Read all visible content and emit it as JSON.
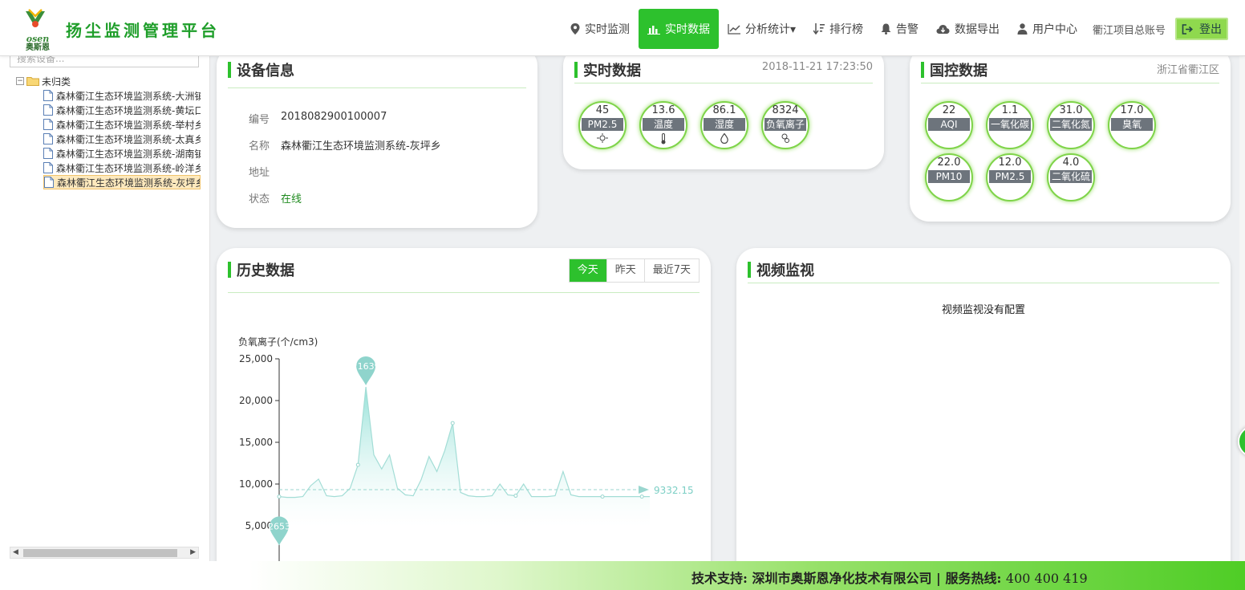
{
  "header": {
    "logo_brand": "osen",
    "logo_cn": "奥斯恩",
    "title": "扬尘监测管理平台",
    "nav": [
      {
        "label": "实时监测",
        "icon": "map-marker-icon"
      },
      {
        "label": "实时数据",
        "icon": "bar-chart-icon",
        "active": true
      },
      {
        "label": "分析统计▾",
        "icon": "line-chart-icon"
      },
      {
        "label": "排行榜",
        "icon": "sort-icon"
      },
      {
        "label": "告警",
        "icon": "bell-icon"
      },
      {
        "label": "数据导出",
        "icon": "cloud-download-icon"
      },
      {
        "label": "用户中心",
        "icon": "user-icon"
      }
    ],
    "account": "衢江项目总账号",
    "logout": "登出",
    "accent_color": "#2dc12d"
  },
  "sidebar": {
    "search_placeholder": "搜索设备...",
    "root_label": "未归类",
    "devices": [
      "森林衢江生态环境监测系统-大洲镇",
      "森林衢江生态环境监测系统-黄坛口",
      "森林衢江生态环境监测系统-举村乡",
      "森林衢江生态环境监测系统-太真乡",
      "森林衢江生态环境监测系统-湖南镇",
      "森林衢江生态环境监测系统-岭洋乡",
      "森林衢江生态环境监测系统-灰坪乡"
    ]
  },
  "device_info": {
    "title": "设备信息",
    "rows": [
      {
        "label": "编号",
        "value": "2018082900100007"
      },
      {
        "label": "名称",
        "value": "森林衢江生态环境监测系统-灰坪乡"
      },
      {
        "label": "地址",
        "value": ""
      },
      {
        "label": "状态",
        "value": "在线"
      }
    ]
  },
  "realtime": {
    "title": "实时数据",
    "timestamp": "2018-11-21 17:23:50",
    "gauges": [
      {
        "value": "45",
        "label": "PM2.5",
        "icon": "dust-icon"
      },
      {
        "value": "13.6",
        "label": "温度",
        "icon": "thermometer-icon"
      },
      {
        "value": "86.1",
        "label": "湿度",
        "icon": "droplet-icon"
      },
      {
        "value": "8324",
        "label": "负氧离子",
        "icon": "ion-icon"
      }
    ]
  },
  "national": {
    "title": "国控数据",
    "location": "浙江省衢江区",
    "gauges": [
      {
        "value": "22",
        "label": "AQI"
      },
      {
        "value": "1.1",
        "label": "一氧化碳"
      },
      {
        "value": "31.0",
        "label": "二氧化氮"
      },
      {
        "value": "17.0",
        "label": "臭氧"
      },
      {
        "value": "22.0",
        "label": "PM10"
      },
      {
        "value": "12.0",
        "label": "PM2.5"
      },
      {
        "value": "4.0",
        "label": "二氧化硫"
      }
    ]
  },
  "history": {
    "title": "历史数据",
    "tabs": [
      "今天",
      "昨天",
      "最近7天"
    ],
    "active_tab": 0
  },
  "chart_data": {
    "type": "area",
    "ylabel": "负氧离子(个/cm3)",
    "ylim": [
      0,
      25000
    ],
    "yticks": [
      "25,000",
      "20,000",
      "15,000",
      "10,000",
      "5,000"
    ],
    "ytick_values": [
      25000,
      20000,
      15000,
      10000,
      5000
    ],
    "max_label": "21639",
    "min_label": "2653",
    "avg_label": "9332.15",
    "avg": 9332.15,
    "series_color": "#9fe3dc",
    "points": [
      [
        0,
        8500
      ],
      [
        1,
        8400
      ],
      [
        2,
        8400
      ],
      [
        3,
        8500
      ],
      [
        4,
        9800
      ],
      [
        5,
        10600
      ],
      [
        6,
        8600
      ],
      [
        7,
        8500
      ],
      [
        8,
        8600
      ],
      [
        9,
        9500
      ],
      [
        10,
        12300
      ],
      [
        11,
        21639
      ],
      [
        12,
        13500
      ],
      [
        13,
        11800
      ],
      [
        14,
        13500
      ],
      [
        15,
        9500
      ],
      [
        16,
        8700
      ],
      [
        17,
        8600
      ],
      [
        18,
        10500
      ],
      [
        19,
        13300
      ],
      [
        20,
        11500
      ],
      [
        21,
        14000
      ],
      [
        22,
        17300
      ],
      [
        23,
        9000
      ],
      [
        24,
        8600
      ],
      [
        25,
        8500
      ],
      [
        26,
        8500
      ],
      [
        27,
        8600
      ],
      [
        28,
        10000
      ],
      [
        29,
        8700
      ],
      [
        30,
        8600
      ],
      [
        31,
        10000
      ],
      [
        32,
        8500
      ],
      [
        33,
        8500
      ],
      [
        34,
        8500
      ],
      [
        35,
        8600
      ],
      [
        36,
        11500
      ],
      [
        37,
        8700
      ],
      [
        38,
        8500
      ],
      [
        39,
        8500
      ],
      [
        40,
        8500
      ],
      [
        41,
        8500
      ],
      [
        42,
        8500
      ],
      [
        43,
        8500
      ],
      [
        44,
        8500
      ],
      [
        45,
        8500
      ],
      [
        46,
        8500
      ],
      [
        47,
        8500
      ]
    ]
  },
  "video": {
    "title": "视频监视",
    "message": "视频监视没有配置"
  },
  "footer": {
    "support": "技术支持: 深圳市奥斯恩净化技术有限公司 | 服务热线: ",
    "hotline": "400 400 419"
  }
}
